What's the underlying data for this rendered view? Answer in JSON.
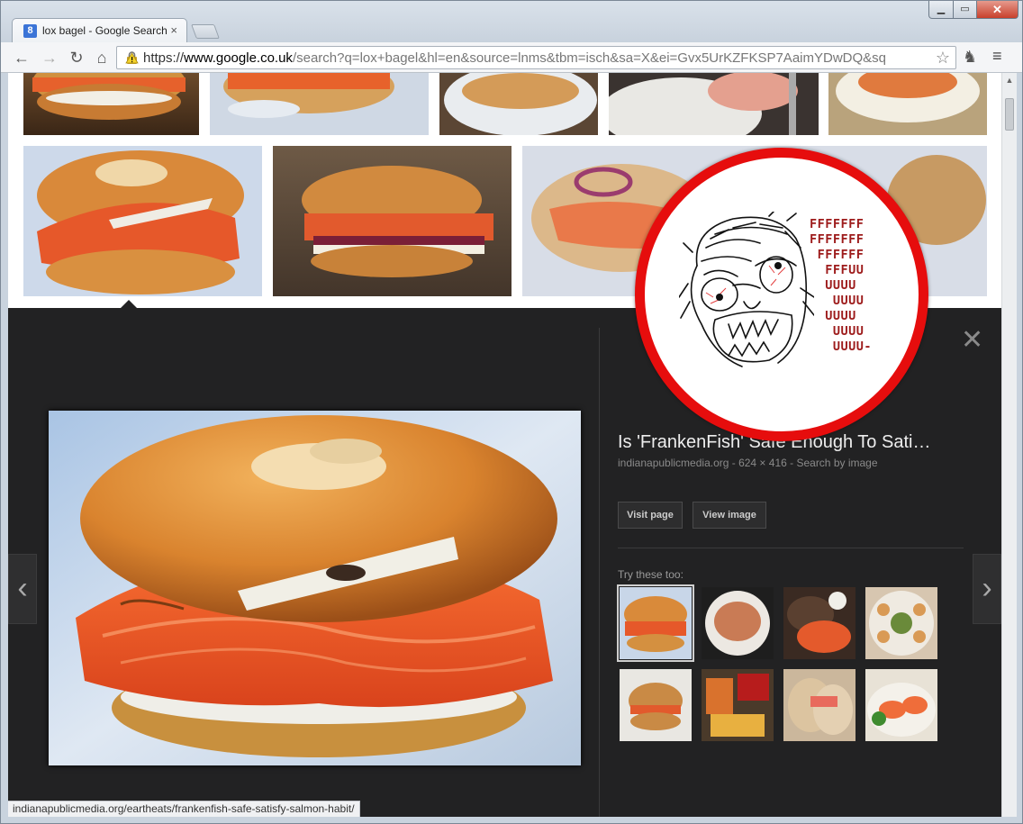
{
  "browser": {
    "tab_title": "lox bagel - Google Search",
    "favicon_letter": "8",
    "tab_close": "×",
    "url_https": "https://",
    "url_host": "www.google.co.uk",
    "url_rest": "/search?q=lox+bagel&hl=en&source=lnms&tbm=isch&sa=X&ei=Gvx5UrKZFKSP7AaimYDwDQ&sq",
    "back": "←",
    "forward": "→",
    "reload": "↻",
    "home": "⌂",
    "star": "☆",
    "menu": "≡",
    "extension": "♞",
    "close_window": "✕"
  },
  "detail": {
    "title": "Is 'FrankenFish' Safe Enough To Sati…",
    "meta": "indianapublicmedia.org - 624 × 416 - Search by image",
    "visit_page": "Visit page",
    "view_image": "View image",
    "try_these": "Try these too:",
    "close": "✕",
    "prev": "‹",
    "next": "›"
  },
  "status_url": "indianapublicmedia.org/eartheats/frankenfish-safe-satisfy-salmon-habit/",
  "meme": {
    "lines": [
      "FFFFFFF",
      "FFFFFFF",
      " FFFFFF",
      "  FFFUU",
      "  UUUU",
      "   UUUU",
      "  UUUU",
      "   UUUU",
      "   UUUU-"
    ]
  },
  "colors": {
    "overlay_ring": "#e60d0d",
    "panel_bg": "#222223",
    "salmon": "#e8582a",
    "bagel": "#d98a3c"
  }
}
